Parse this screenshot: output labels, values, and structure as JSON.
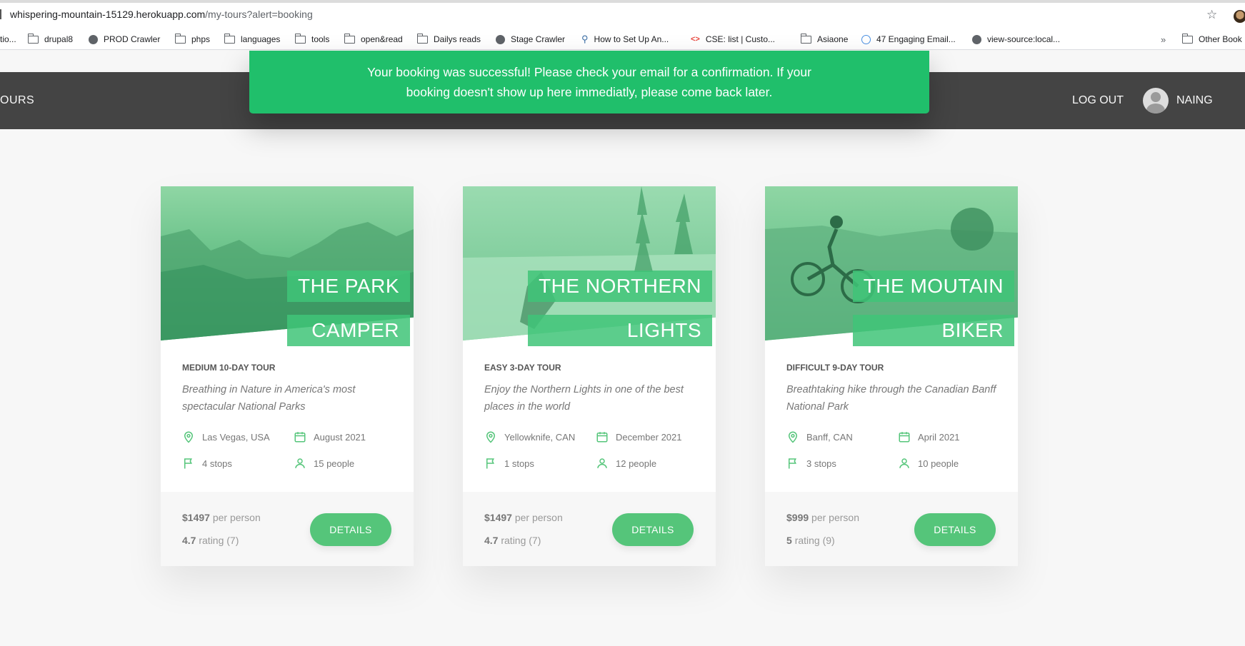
{
  "browser": {
    "url_host": "whispering-mountain-15129.herokuapp.com",
    "url_path": "/my-tours?alert=booking",
    "bookmarks": [
      {
        "label": "tio...",
        "icon": "none"
      },
      {
        "label": "drupal8",
        "icon": "folder-icon"
      },
      {
        "label": "PROD Crawler",
        "icon": "globe-icon"
      },
      {
        "label": "phps",
        "icon": "folder-icon"
      },
      {
        "label": "languages",
        "icon": "folder-icon"
      },
      {
        "label": "tools",
        "icon": "folder-icon"
      },
      {
        "label": "open&read",
        "icon": "folder-icon"
      },
      {
        "label": "Dailys reads",
        "icon": "folder-icon"
      },
      {
        "label": "Stage Crawler",
        "icon": "globe-icon"
      },
      {
        "label": "How to Set Up An...",
        "icon": "tree-icon"
      },
      {
        "label": "CSE: list  |  Custo...",
        "icon": "code-icon"
      },
      {
        "label": "Asiaone",
        "icon": "folder-icon"
      },
      {
        "label": "47 Engaging Email...",
        "icon": "clock-icon"
      },
      {
        "label": "view-source:local...",
        "icon": "globe-icon"
      },
      {
        "label": "Other Book",
        "icon": "folder-icon"
      }
    ],
    "overflow": "»"
  },
  "header": {
    "nav_left": "OURS",
    "logout": "LOG OUT",
    "user_name": "NAING"
  },
  "alert": {
    "text": "Your booking was successful! Please check your email for a confirmation. If your booking doesn't show up here immediatly, please come back later."
  },
  "colors": {
    "brand_green": "#55c57a",
    "alert_green": "#20bf6b",
    "header_dark": "#444444"
  },
  "tours": [
    {
      "title_l1": "THE PARK",
      "title_l2": "CAMPER",
      "difficulty": "MEDIUM 10-DAY TOUR",
      "summary": "Breathing in Nature in America's most spectacular National Parks",
      "location": "Las Vegas, USA",
      "date": "August 2021",
      "stops": "4 stops",
      "people": "15 people",
      "price": "$1497",
      "price_suffix": "per person",
      "rating": "4.7",
      "rating_suffix": "rating (7)",
      "button": "DETAILS"
    },
    {
      "title_l1": "THE NORTHERN",
      "title_l2": "LIGHTS",
      "difficulty": "EASY 3-DAY TOUR",
      "summary": "Enjoy the Northern Lights in one of the best places in the world",
      "location": "Yellowknife, CAN",
      "date": "December 2021",
      "stops": "1 stops",
      "people": "12 people",
      "price": "$1497",
      "price_suffix": "per person",
      "rating": "4.7",
      "rating_suffix": "rating (7)",
      "button": "DETAILS"
    },
    {
      "title_l1": "THE MOUTAIN",
      "title_l2": "BIKER",
      "difficulty": "DIFFICULT 9-DAY TOUR",
      "summary": "Breathtaking hike through the Canadian Banff National Park",
      "location": "Banff, CAN",
      "date": "April 2021",
      "stops": "3 stops",
      "people": "10 people",
      "price": "$999",
      "price_suffix": "per person",
      "rating": "5",
      "rating_suffix": "rating (9)",
      "button": "DETAILS"
    }
  ]
}
